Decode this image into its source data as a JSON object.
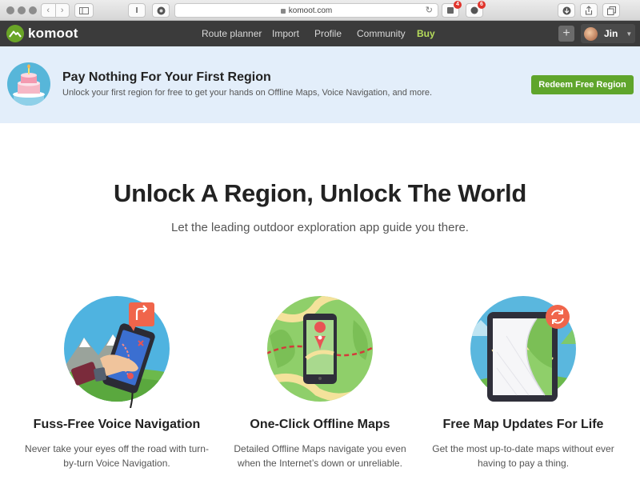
{
  "browser": {
    "url": "komoot.com",
    "extension_badges": [
      "4",
      "6"
    ]
  },
  "header": {
    "brand": "komoot",
    "nav": [
      {
        "label": "Route planner"
      },
      {
        "label": "Import"
      },
      {
        "label": "Profile"
      },
      {
        "label": "Community"
      },
      {
        "label": "Buy"
      }
    ],
    "user_name": "Jin"
  },
  "promo": {
    "title": "Pay Nothing For Your First Region",
    "subtitle": "Unlock your first region for free to get your hands on Offline Maps, Voice Navigation, and more.",
    "button": "Redeem Free Region"
  },
  "hero": {
    "title": "Unlock A Region, Unlock The World",
    "subtitle": "Let the leading outdoor exploration app guide you there."
  },
  "features": [
    {
      "title": "Fuss-Free Voice Navigation",
      "text": "Never take your eyes off the road with turn-by-turn Voice Navigation."
    },
    {
      "title": "One-Click Offline Maps",
      "text": "Detailed Offline Maps navigate you even when the Internet’s down or unreliable."
    },
    {
      "title": "Free Map Updates For Life",
      "text": "Get the most up-to-date maps without ever having to pay a thing."
    }
  ],
  "colors": {
    "accent_green": "#5fa52b",
    "buy_link": "#b6dc5b",
    "banner_bg": "#e3eefa",
    "header_bg": "#3b3b3b",
    "update_badge": "#f0654b"
  }
}
